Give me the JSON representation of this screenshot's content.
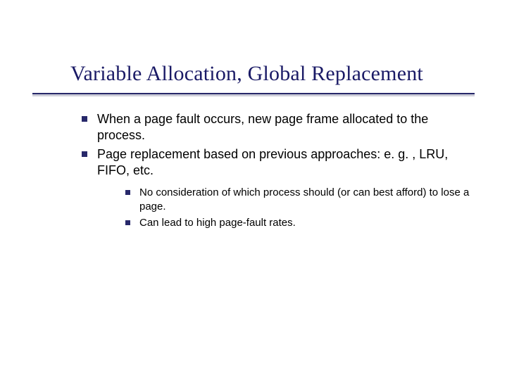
{
  "slide": {
    "title": "Variable Allocation, Global Replacement",
    "bullets": [
      "When a page fault occurs, new page frame allocated to the process.",
      "Page replacement based on previous approaches: e. g. , LRU, FIFO, etc."
    ],
    "sub_bullets": [
      "No consideration of which process should (or can best afford) to lose a page.",
      "Can lead to high page-fault rates."
    ]
  }
}
